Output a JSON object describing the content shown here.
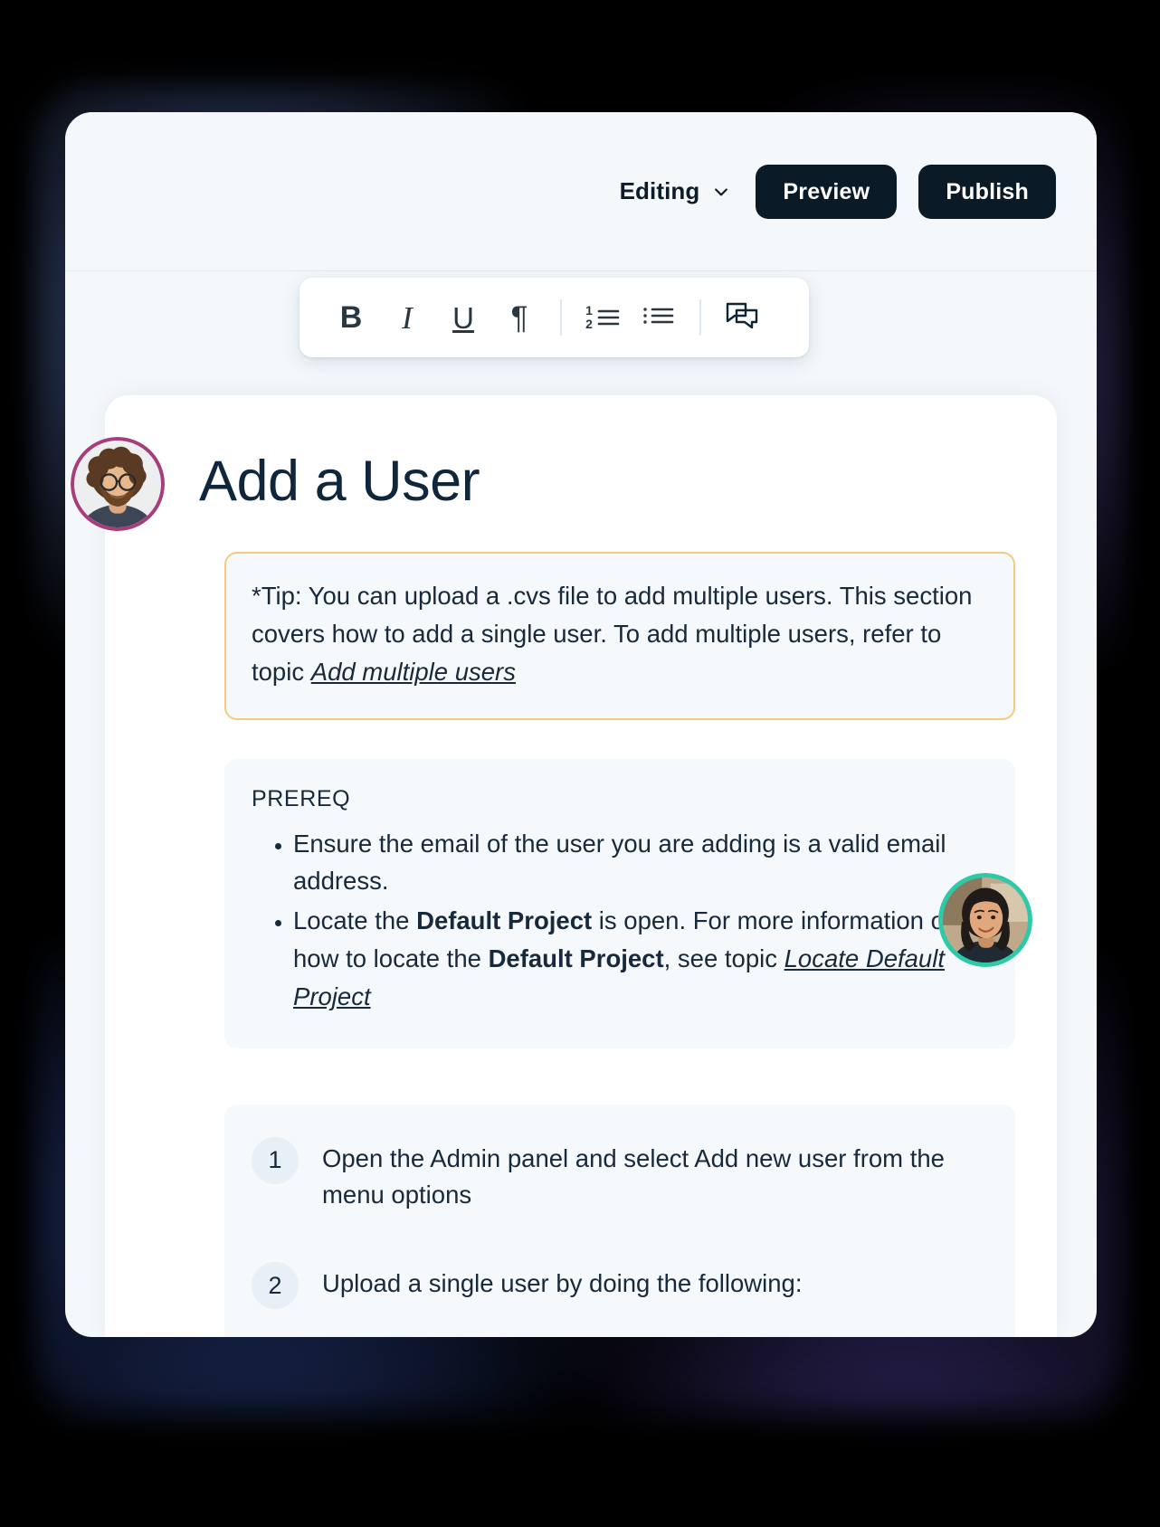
{
  "window": {
    "topbar": {
      "mode_label": "Editing",
      "chevron_icon": "chevron-down-icon",
      "preview_label": "Preview",
      "publish_label": "Publish"
    },
    "toolbar": {
      "items": [
        {
          "name": "bold-button",
          "glyph": "B",
          "icon": "bold-icon"
        },
        {
          "name": "italic-button",
          "glyph": "I",
          "icon": "italic-icon"
        },
        {
          "name": "underline-button",
          "glyph": "U",
          "icon": "underline-icon"
        },
        {
          "name": "paragraph-button",
          "glyph": "¶",
          "icon": "paragraph-icon"
        },
        {
          "name": "numbered-list-button",
          "glyph": "",
          "icon": "ordered-list-icon"
        },
        {
          "name": "bullet-list-button",
          "glyph": "",
          "icon": "bullet-list-icon"
        },
        {
          "name": "comment-button",
          "glyph": "",
          "icon": "comment-icon"
        }
      ],
      "ordered_list_digits": {
        "one": "1",
        "two": "2"
      }
    }
  },
  "document": {
    "title": "Add a User",
    "tip": {
      "text_before_link": "*Tip: You can upload a .cvs file to add multiple users. This section covers how to add a single user. To add multiple users, refer to topic ",
      "link_label": "Add multiple users"
    },
    "prereq": {
      "label": "PREREQ",
      "items": [
        {
          "segments": [
            {
              "text": "Ensure the email of the user you are adding is a valid email address.",
              "style": "normal"
            }
          ]
        },
        {
          "segments": [
            {
              "text": "Locate the ",
              "style": "normal"
            },
            {
              "text": "Default Project",
              "style": "bold"
            },
            {
              "text": " is open. For more information on how to locate the ",
              "style": "normal"
            },
            {
              "text": "Default Project",
              "style": "bold"
            },
            {
              "text": ", see topic ",
              "style": "normal"
            },
            {
              "text": "Locate Default Project",
              "style": "link"
            }
          ]
        }
      ]
    },
    "steps": [
      {
        "number": "1",
        "text": "Open the Admin panel and select Add new user from the menu options"
      },
      {
        "number": "2",
        "text": "Upload a single user by doing the following:"
      }
    ]
  },
  "avatars": [
    {
      "name": "avatar-author",
      "ring_color": "#a83d7c",
      "alt": "author-avatar"
    },
    {
      "name": "avatar-reviewer",
      "ring_color": "#2ec9a8",
      "alt": "reviewer-avatar"
    }
  ],
  "colors": {
    "button_dark": "#0a1a26",
    "tip_border": "#f4cb7e",
    "panel_bg": "#f5f9fc",
    "app_bg": "#f4f8fb",
    "text": "#17293a"
  }
}
